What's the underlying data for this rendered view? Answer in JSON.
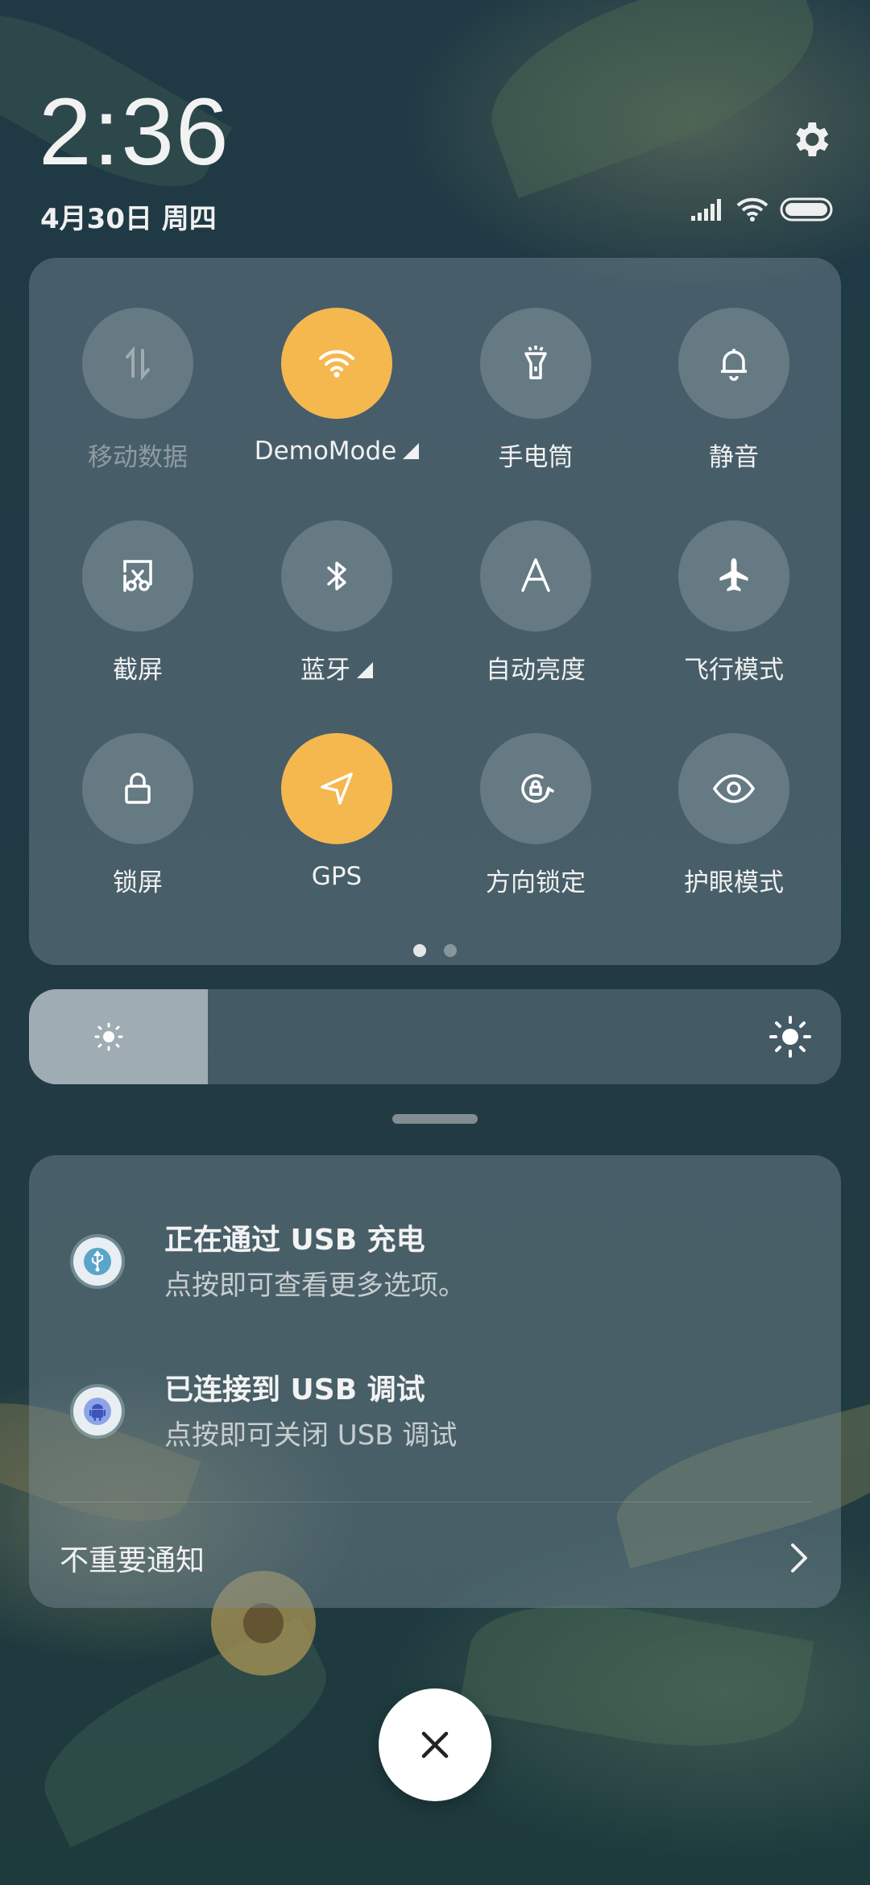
{
  "status_bar": {
    "time": "2:36",
    "date": "4月30日 周四"
  },
  "quick_settings": {
    "tiles": [
      {
        "label": "移动数据",
        "icon": "mobile-data-icon",
        "active": false,
        "disabled": true
      },
      {
        "label": "DemoMode",
        "icon": "wifi-icon",
        "active": true,
        "expandable": true
      },
      {
        "label": "手电筒",
        "icon": "flashlight-icon",
        "active": false
      },
      {
        "label": "静音",
        "icon": "bell-icon",
        "active": false
      },
      {
        "label": "截屏",
        "icon": "screenshot-icon",
        "active": false
      },
      {
        "label": "蓝牙",
        "icon": "bluetooth-icon",
        "active": false,
        "expandable": true
      },
      {
        "label": "自动亮度",
        "icon": "auto-brightness-icon",
        "active": false
      },
      {
        "label": "飞行模式",
        "icon": "airplane-icon",
        "active": false
      },
      {
        "label": "锁屏",
        "icon": "lock-icon",
        "active": false
      },
      {
        "label": "GPS",
        "icon": "location-icon",
        "active": true
      },
      {
        "label": "方向锁定",
        "icon": "rotation-lock-icon",
        "active": false
      },
      {
        "label": "护眼模式",
        "icon": "eye-icon",
        "active": false
      }
    ],
    "page_count": 2,
    "current_page": 1
  },
  "brightness": {
    "level_fraction": 0.22
  },
  "notifications": [
    {
      "title": "正在通过 USB 充电",
      "subtitle": "点按即可查看更多选项。",
      "icon": "usb-icon"
    },
    {
      "title": "已连接到 USB 调试",
      "subtitle": "点按即可关闭 USB 调试",
      "icon": "android-icon"
    }
  ],
  "unimportant_label": "不重要通知",
  "colors": {
    "accent": "#f4b84f"
  }
}
